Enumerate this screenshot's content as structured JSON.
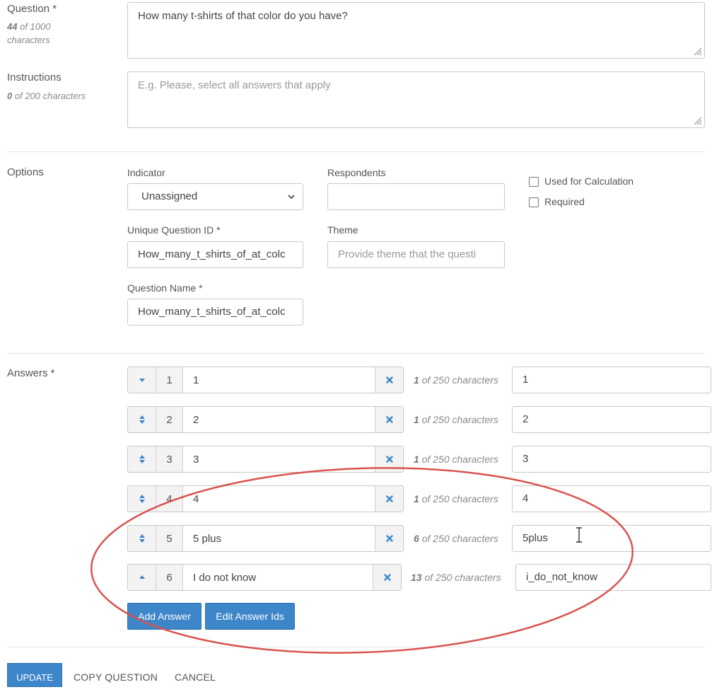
{
  "question": {
    "label": "Question *",
    "count_num": "44",
    "count_rest": "of 1000",
    "count_line2": "characters",
    "value": "How many t-shirts of that color do you have?"
  },
  "instructions": {
    "label": "Instructions",
    "count_num": "0",
    "count_rest": "of 200 characters",
    "placeholder": "E.g. Please, select all answers that apply"
  },
  "options": {
    "label": "Options",
    "indicator_label": "Indicator",
    "indicator_value": "Unassigned",
    "respondents_label": "Respondents",
    "respondents_value": "",
    "used_for_calculation": "Used for Calculation",
    "required": "Required",
    "unique_id_label": "Unique Question ID *",
    "unique_id_value": "How_many_t_shirts_of_at_colc",
    "theme_label": "Theme",
    "theme_placeholder": "Provide theme that the questi",
    "question_name_label": "Question Name *",
    "question_name_value": "How_many_t_shirts_of_at_colc"
  },
  "answers": {
    "label": "Answers *",
    "count_suffix": "of 250 characters",
    "rows": [
      {
        "num": "1",
        "text": "1",
        "count": "1",
        "id": "1"
      },
      {
        "num": "2",
        "text": "2",
        "count": "1",
        "id": "2"
      },
      {
        "num": "3",
        "text": "3",
        "count": "1",
        "id": "3"
      },
      {
        "num": "4",
        "text": "4",
        "count": "1",
        "id": "4"
      },
      {
        "num": "5",
        "text": "5 plus",
        "count": "6",
        "id": "5plus"
      },
      {
        "num": "6",
        "text": "I do not know",
        "count": "13",
        "id": "i_do_not_know"
      }
    ],
    "add_answer": "Add Answer",
    "edit_ids": "Edit Answer Ids"
  },
  "footer": {
    "update": "UPDATE",
    "copy": "COPY QUESTION",
    "cancel": "CANCEL"
  },
  "colors": {
    "accent": "#3d86c9",
    "annotation_ellipse": "#d9534f"
  },
  "icons": [
    "resize-grip-icon",
    "chevron-down-icon",
    "sort-arrows-icon",
    "sort-down-icon",
    "sort-up-icon",
    "close-x-icon",
    "text-cursor-icon"
  ]
}
